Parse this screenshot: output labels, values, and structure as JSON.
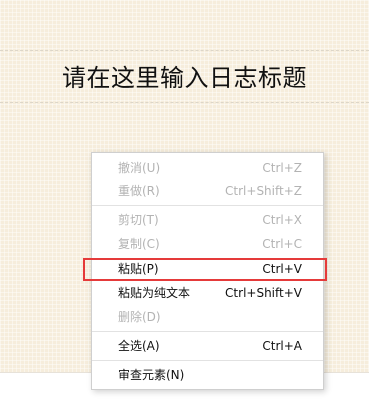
{
  "editor": {
    "title_placeholder": "请在这里输入日志标题"
  },
  "context_menu": {
    "items": [
      {
        "label": "撤消(U)",
        "shortcut": "Ctrl+Z",
        "enabled": false
      },
      {
        "label": "重做(R)",
        "shortcut": "Ctrl+Shift+Z",
        "enabled": false
      },
      {
        "label": "剪切(T)",
        "shortcut": "Ctrl+X",
        "enabled": false
      },
      {
        "label": "复制(C)",
        "shortcut": "Ctrl+C",
        "enabled": false
      },
      {
        "label": "粘贴(P)",
        "shortcut": "Ctrl+V",
        "enabled": true,
        "highlighted": true
      },
      {
        "label": "粘贴为纯文本",
        "shortcut": "Ctrl+Shift+V",
        "enabled": true
      },
      {
        "label": "删除(D)",
        "shortcut": "",
        "enabled": false
      },
      {
        "label": "全选(A)",
        "shortcut": "Ctrl+A",
        "enabled": true
      },
      {
        "label": "审查元素(N)",
        "shortcut": "",
        "enabled": true
      }
    ]
  },
  "colors": {
    "highlight_border": "#e53a3a",
    "disabled_text": "#b3b3b3",
    "paper_background": "#f6eddc"
  }
}
